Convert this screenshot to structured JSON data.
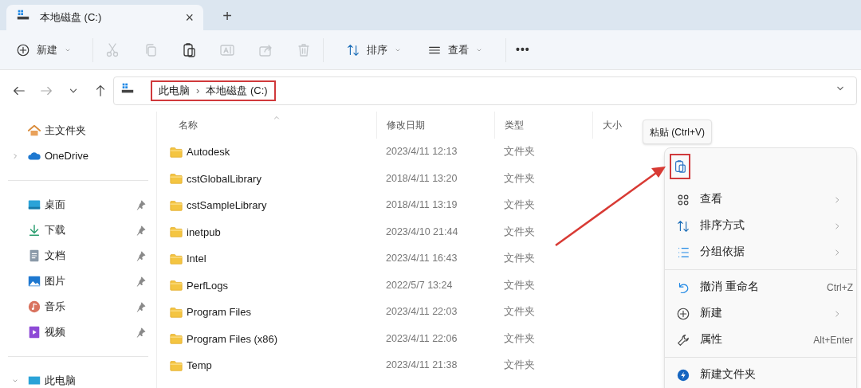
{
  "tab": {
    "title": "本地磁盘 (C:)",
    "close": "×",
    "new_tab": "+"
  },
  "toolbar": [
    {
      "kind": "new",
      "label": "新建",
      "disabled": false
    },
    {
      "kind": "cut",
      "disabled": true
    },
    {
      "kind": "copy",
      "disabled": true
    },
    {
      "kind": "paste",
      "disabled": false
    },
    {
      "kind": "rename",
      "disabled": true
    },
    {
      "kind": "share",
      "disabled": true
    },
    {
      "kind": "delete",
      "disabled": true
    },
    {
      "kind": "sort",
      "label": "排序",
      "disabled": false
    },
    {
      "kind": "view",
      "label": "查看",
      "disabled": false
    },
    {
      "kind": "more",
      "label": "•••",
      "disabled": false
    }
  ],
  "address": {
    "breadcrumbs": [
      "此电脑",
      "本地磁盘 (C:)"
    ],
    "separator": "›"
  },
  "sidebar": {
    "groups": [
      [
        {
          "label": "主文件夹",
          "expandable": false,
          "pinned": false
        },
        {
          "label": "OneDrive",
          "expandable": true,
          "pinned": false
        }
      ],
      [
        {
          "label": "桌面",
          "expandable": false,
          "pinned": true
        },
        {
          "label": "下载",
          "expandable": false,
          "pinned": true
        },
        {
          "label": "文档",
          "expandable": false,
          "pinned": true
        },
        {
          "label": "图片",
          "expandable": false,
          "pinned": true
        },
        {
          "label": "音乐",
          "expandable": false,
          "pinned": true
        },
        {
          "label": "视频",
          "expandable": false,
          "pinned": true
        }
      ],
      [
        {
          "label": "此电脑",
          "expandable": true,
          "pinned": false
        }
      ]
    ]
  },
  "table": {
    "columns": [
      "名称",
      "修改日期",
      "类型",
      "大小"
    ],
    "rows": [
      [
        "Autodesk",
        "2023/4/11 12:13",
        "文件夹"
      ],
      [
        "cstGlobalLibrary",
        "2018/4/11 13:20",
        "文件夹"
      ],
      [
        "cstSampleLibrary",
        "2018/4/11 13:19",
        "文件夹"
      ],
      [
        "inetpub",
        "2023/4/10 21:44",
        "文件夹"
      ],
      [
        "Intel",
        "2023/4/11 16:43",
        "文件夹"
      ],
      [
        "PerfLogs",
        "2022/5/7 13:24",
        "文件夹"
      ],
      [
        "Program Files",
        "2023/4/11 22:03",
        "文件夹"
      ],
      [
        "Program Files (x86)",
        "2023/4/11 22:06",
        "文件夹"
      ],
      [
        "Temp",
        "2023/4/11 21:38",
        "文件夹"
      ]
    ]
  },
  "tooltip": "粘贴 (Ctrl+V)",
  "context_menu": [
    {
      "kind": "icon-row"
    },
    {
      "kind": "item",
      "label": "查看",
      "has_submenu": true
    },
    {
      "kind": "item",
      "label": "排序方式",
      "has_submenu": true
    },
    {
      "kind": "item",
      "label": "分组依据",
      "has_submenu": true
    },
    {
      "kind": "separator"
    },
    {
      "kind": "item",
      "label": "撤消 重命名",
      "shortcut": "Ctrl+Z",
      "has_submenu": false
    },
    {
      "kind": "item",
      "label": "新建",
      "has_submenu": true
    },
    {
      "kind": "item",
      "label": "属性",
      "shortcut": "Alt+Enter",
      "has_submenu": false
    },
    {
      "kind": "separator"
    },
    {
      "kind": "item",
      "label": "新建文件夹",
      "has_submenu": false
    }
  ]
}
